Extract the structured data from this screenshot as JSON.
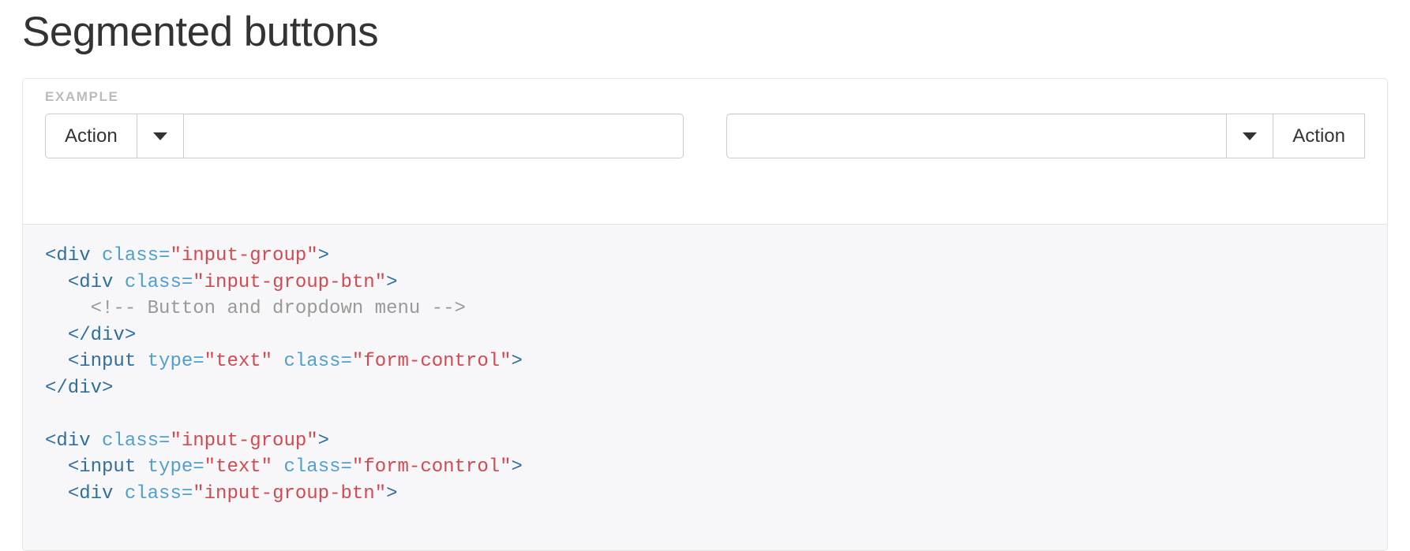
{
  "page": {
    "title": "Segmented buttons"
  },
  "example": {
    "label": "EXAMPLE",
    "groups": [
      {
        "name": "left-input-group",
        "order": [
          "button",
          "caret",
          "input"
        ],
        "button_label": "Action",
        "caret_icon": "caret-down-icon",
        "input_value": "",
        "input_placeholder": ""
      },
      {
        "name": "right-input-group",
        "order": [
          "input",
          "caret",
          "button"
        ],
        "button_label": "Action",
        "caret_icon": "caret-down-icon",
        "input_value": "",
        "input_placeholder": ""
      }
    ]
  },
  "code": {
    "language": "html",
    "lines": [
      [
        {
          "t": "tag",
          "v": "<div "
        },
        {
          "t": "attr",
          "v": "class="
        },
        {
          "t": "string",
          "v": "\"input-group\""
        },
        {
          "t": "tag",
          "v": ">"
        }
      ],
      [
        {
          "t": "plain",
          "v": "  "
        },
        {
          "t": "tag",
          "v": "<div "
        },
        {
          "t": "attr",
          "v": "class="
        },
        {
          "t": "string",
          "v": "\"input-group-btn\""
        },
        {
          "t": "tag",
          "v": ">"
        }
      ],
      [
        {
          "t": "plain",
          "v": "    "
        },
        {
          "t": "cmt",
          "v": "<!-- Button and dropdown menu -->"
        }
      ],
      [
        {
          "t": "plain",
          "v": "  "
        },
        {
          "t": "tag",
          "v": "</div>"
        }
      ],
      [
        {
          "t": "plain",
          "v": "  "
        },
        {
          "t": "tag",
          "v": "<input "
        },
        {
          "t": "attr",
          "v": "type="
        },
        {
          "t": "string",
          "v": "\"text\""
        },
        {
          "t": "plain",
          "v": " "
        },
        {
          "t": "attr",
          "v": "class="
        },
        {
          "t": "string",
          "v": "\"form-control\""
        },
        {
          "t": "tag",
          "v": ">"
        }
      ],
      [
        {
          "t": "tag",
          "v": "</div>"
        }
      ],
      [
        {
          "t": "plain",
          "v": ""
        }
      ],
      [
        {
          "t": "tag",
          "v": "<div "
        },
        {
          "t": "attr",
          "v": "class="
        },
        {
          "t": "string",
          "v": "\"input-group\""
        },
        {
          "t": "tag",
          "v": ">"
        }
      ],
      [
        {
          "t": "plain",
          "v": "  "
        },
        {
          "t": "tag",
          "v": "<input "
        },
        {
          "t": "attr",
          "v": "type="
        },
        {
          "t": "string",
          "v": "\"text\""
        },
        {
          "t": "plain",
          "v": " "
        },
        {
          "t": "attr",
          "v": "class="
        },
        {
          "t": "string",
          "v": "\"form-control\""
        },
        {
          "t": "tag",
          "v": ">"
        }
      ],
      [
        {
          "t": "plain",
          "v": "  "
        },
        {
          "t": "tag",
          "v": "<div "
        },
        {
          "t": "attr",
          "v": "class="
        },
        {
          "t": "string",
          "v": "\"input-group-btn\""
        },
        {
          "t": "tag",
          "v": ">"
        }
      ]
    ]
  },
  "colors": {
    "text": "#333333",
    "card_border": "#e5e5e5",
    "example_label": "#bbbbbb",
    "code_background": "#f7f7f9",
    "code_tag": "#2f6f9f",
    "code_attr": "#4f9fcf",
    "code_string": "#d44950",
    "code_comment": "#999999",
    "control_border": "#cccccc"
  }
}
